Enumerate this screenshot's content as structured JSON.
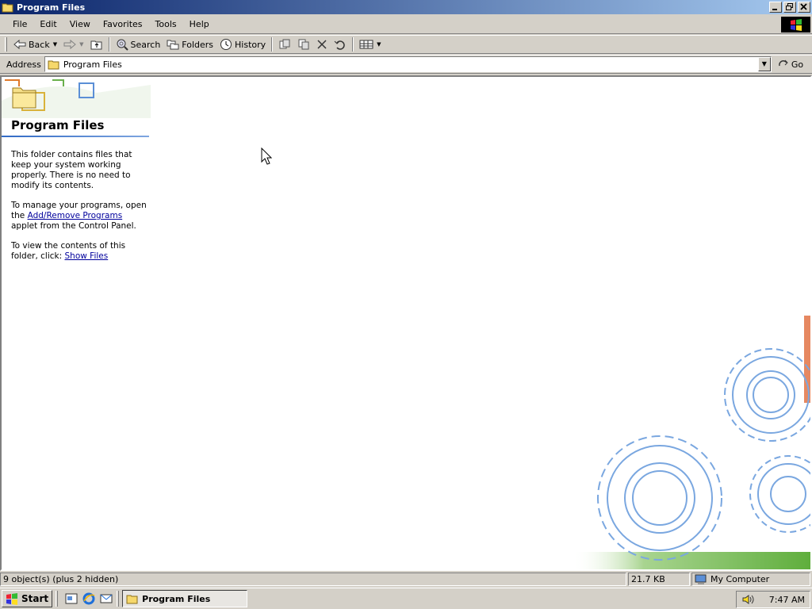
{
  "window": {
    "title": "Program Files",
    "buttons": [
      "minimize",
      "maximize",
      "close"
    ]
  },
  "menu": {
    "items": [
      "File",
      "Edit",
      "View",
      "Favorites",
      "Tools",
      "Help"
    ]
  },
  "toolbar": {
    "back_label": "Back",
    "search_label": "Search",
    "folders_label": "Folders",
    "history_label": "History"
  },
  "address": {
    "label": "Address",
    "value": "Program Files",
    "go_label": "Go"
  },
  "panel": {
    "title": "Program Files",
    "para1": "This folder contains files that keep your system working properly. There is no need to modify its contents.",
    "para2_before": "To manage your programs, open the ",
    "para2_link": "Add/Remove Programs",
    "para2_after": " applet from the Control Panel.",
    "para3_before": "To view the contents of this folder, click: ",
    "para3_link": "Show Files"
  },
  "status": {
    "objects": "9 object(s) (plus 2 hidden)",
    "size": "21.7 KB",
    "zone": "My Computer"
  },
  "taskbar": {
    "start_label": "Start",
    "task_label": "Program Files",
    "clock": "7:47 AM"
  },
  "colors": {
    "title_gradient_start": "#0a246a",
    "title_gradient_end": "#a6caf0",
    "link": "#00009c",
    "gear": "#7aa7e0"
  }
}
